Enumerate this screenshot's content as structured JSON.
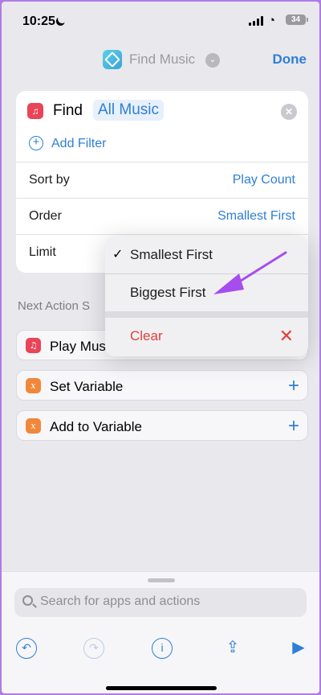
{
  "status_bar": {
    "time": "10:25",
    "battery": "34"
  },
  "nav": {
    "title": "Find Music",
    "done_label": "Done"
  },
  "find_action": {
    "find_label": "Find",
    "source_token": "All Music",
    "add_filter_label": "Add Filter",
    "rows": [
      {
        "label": "Sort by",
        "value": "Play Count"
      },
      {
        "label": "Order",
        "value": "Smallest First"
      },
      {
        "label": "Limit",
        "value": ""
      }
    ]
  },
  "next_actions": {
    "title": "Next Action S",
    "items": [
      {
        "label": "Play Mus",
        "icon": "music-note-icon",
        "color": "#e94457"
      },
      {
        "label": "Set Variable",
        "icon": "variable-icon",
        "color": "#f0883a"
      },
      {
        "label": "Add to Variable",
        "icon": "variable-icon",
        "color": "#f0883a"
      }
    ]
  },
  "order_menu": {
    "items": [
      {
        "label": "Smallest First",
        "checked": true
      },
      {
        "label": "Biggest First",
        "checked": false
      }
    ],
    "clear_label": "Clear"
  },
  "bottom_panel": {
    "search_placeholder": "Search for apps and actions"
  },
  "colors": {
    "accent": "#2f7fd6",
    "destructive": "#e0413a",
    "annotation_arrow": "#a64df0"
  }
}
